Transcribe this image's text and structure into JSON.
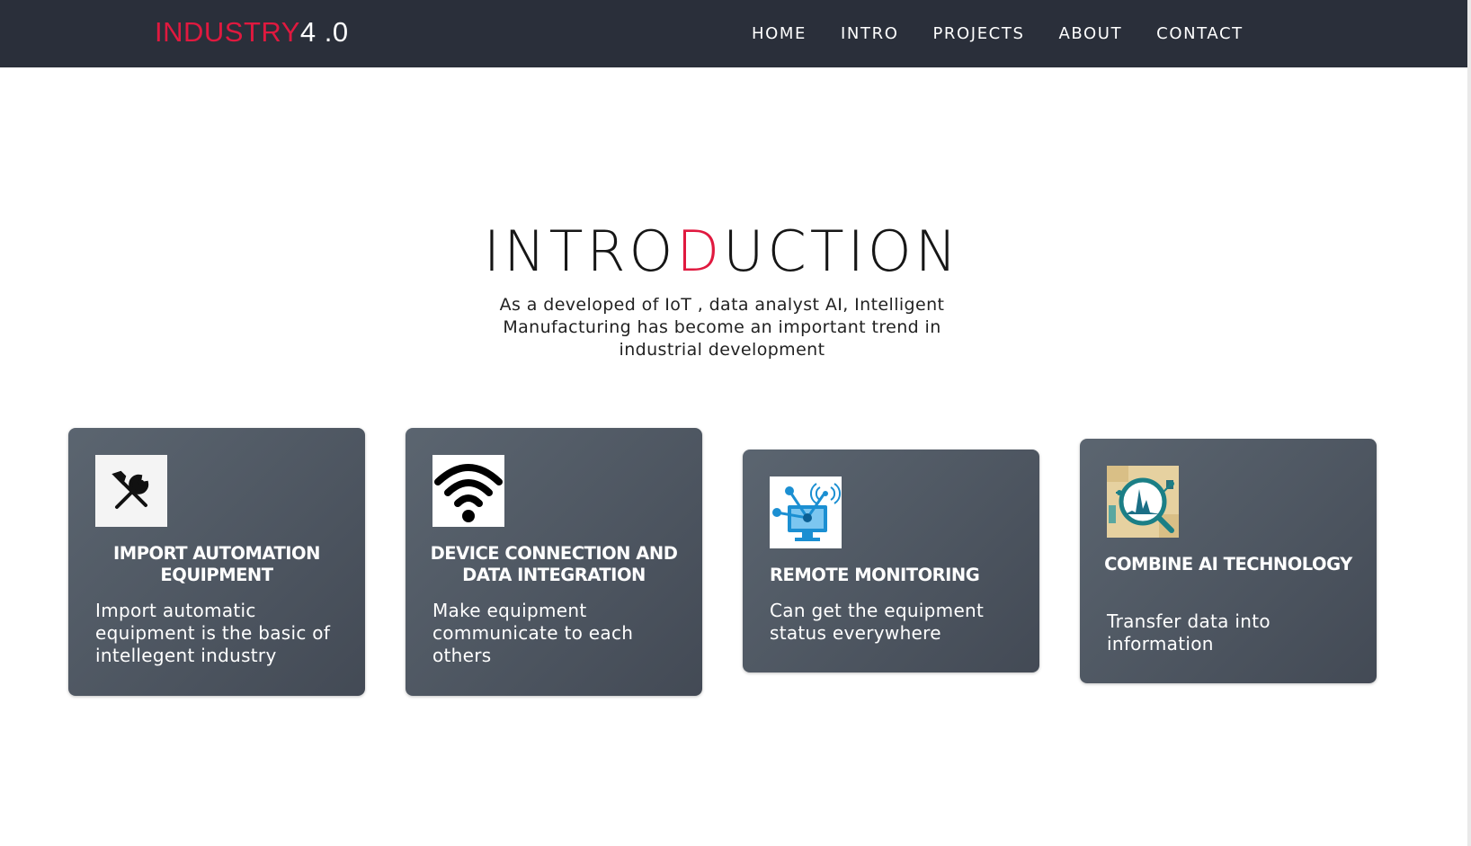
{
  "navbar": {
    "logo_red": "INDUSTRY",
    "logo_white": "4 .0",
    "links": [
      "HOME",
      "INTRO",
      "PROJECTS",
      "ABOUT",
      "CONTACT"
    ]
  },
  "intro": {
    "title_a": "INTRO",
    "title_accent": "D",
    "title_b": "UCTION",
    "desc": "As a developed of IoT , data analyst AI, Intelligent Manufacturing has become an important trend in industrial development"
  },
  "cards": [
    {
      "icon": "tools-icon",
      "title": "IMPORT AUTOMATION EQUIPMENT",
      "desc": "Import automatic equipment is the basic of intellegent industry"
    },
    {
      "icon": "wifi-icon",
      "title": "DEVICE CONNECTION AND DATA INTEGRATION",
      "desc": "Make equipment communicate to each others"
    },
    {
      "icon": "remote-monitor-icon",
      "title": "REMOTE MONITORING",
      "desc": "Can get the equipment status everywhere"
    },
    {
      "icon": "ai-analytics-icon",
      "title": "COMBINE AI TECHNOLOGY",
      "desc": "Transfer data into information"
    }
  ],
  "colors": {
    "accent": "#e0193f",
    "navbar": "#2a2f3a",
    "card": "#4f5762"
  }
}
